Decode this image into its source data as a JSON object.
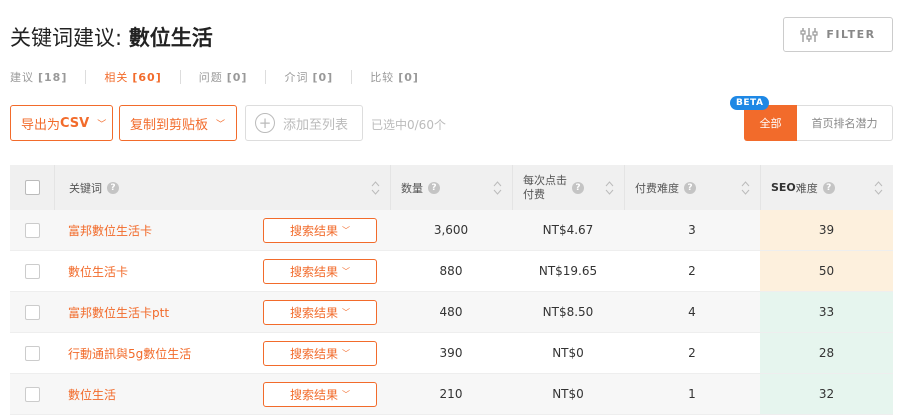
{
  "header": {
    "title_prefix": "关键词建议: ",
    "title_keyword": "數位生活",
    "filter_label": "FILTER"
  },
  "tabs": [
    {
      "label": "建议",
      "count": "[18]",
      "active": false
    },
    {
      "label": "相关",
      "count": "[60]",
      "active": true
    },
    {
      "label": "问题",
      "count": "[0]",
      "active": false
    },
    {
      "label": "介词",
      "count": "[0]",
      "active": false
    },
    {
      "label": "比较",
      "count": "[0]",
      "active": false
    }
  ],
  "toolbar": {
    "export_prefix": "导出为",
    "export_format": "CSV",
    "copy_label": "复制到剪贴板",
    "add_label": "添加至列表",
    "selected_text": "已选中0/60个"
  },
  "segment": {
    "beta_badge": "BETA",
    "all_label": "全部",
    "top_label": "首页排名潜力"
  },
  "table": {
    "headers": {
      "keyword": "关键词",
      "volume": "数量",
      "cpc_line1": "每次点击",
      "cpc_line2": "付费",
      "pd": "付费难度",
      "seo_bold": "SEO",
      "seo_rest": "难度"
    },
    "serp_label": "搜索结果",
    "rows": [
      {
        "keyword": "富邦數位生活卡",
        "volume": "3,600",
        "cpc": "NT$4.67",
        "pd": "3",
        "seo": "39",
        "seo_level": "warn"
      },
      {
        "keyword": "數位生活卡",
        "volume": "880",
        "cpc": "NT$19.65",
        "pd": "2",
        "seo": "50",
        "seo_level": "warn"
      },
      {
        "keyword": "富邦數位生活卡ptt",
        "volume": "480",
        "cpc": "NT$8.50",
        "pd": "4",
        "seo": "33",
        "seo_level": "good"
      },
      {
        "keyword": "行動通訊與5g數位生活",
        "volume": "390",
        "cpc": "NT$0",
        "pd": "2",
        "seo": "28",
        "seo_level": "good"
      },
      {
        "keyword": "數位生活",
        "volume": "210",
        "cpc": "NT$0",
        "pd": "1",
        "seo": "32",
        "seo_level": "good"
      }
    ]
  },
  "colors": {
    "accent": "#f26b2b",
    "beta": "#1e88e5",
    "seo_warn_bg": "#fdf0dd",
    "seo_good_bg": "#e6f5ee"
  },
  "icons": {
    "filter": "sliders-icon",
    "info": "info-icon",
    "sort": "sort-arrows-icon",
    "chevron": "chevron-down-icon",
    "plus": "plus-circle-icon"
  }
}
